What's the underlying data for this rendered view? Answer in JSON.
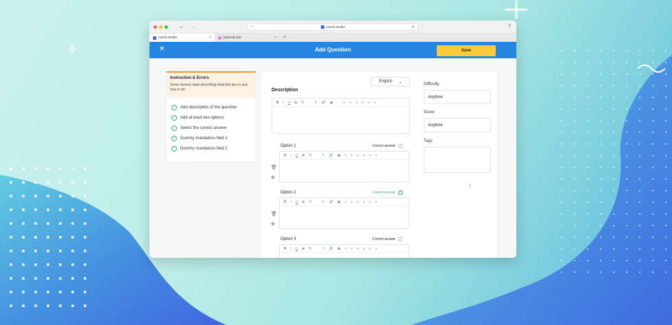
{
  "colors": {
    "brand": "#2685e0",
    "save": "#fbc93a",
    "success": "#3bb273",
    "warning_accent": "#f59a2b"
  },
  "browser": {
    "url": "numb.studio",
    "tabs": [
      {
        "label": "numb.studio",
        "close": "×"
      },
      {
        "label": "joseruiz.me",
        "close": "×"
      }
    ],
    "new_tab": "+"
  },
  "header": {
    "title": "Add Question",
    "close_icon": "✕",
    "save_label": "Save"
  },
  "instructions": {
    "title": "Instruction & Errors",
    "description": "Some dummy state describing what this box is and how to do",
    "items": [
      {
        "label": "Add description of the question"
      },
      {
        "label": "Add at least two options"
      },
      {
        "label": "Select the correct answer"
      },
      {
        "label": "Dummy mandatoru field 1"
      },
      {
        "label": "Dummy mandatoru field 2"
      }
    ]
  },
  "editor": {
    "language": "English",
    "description_label": "Description",
    "toolbar_icons": [
      "B",
      "I",
      "U",
      "S",
      "Tt",
      "✎",
      "🔗",
      "▣",
      "≡",
      "≡",
      "≡",
      "≡",
      "≡",
      "≡"
    ]
  },
  "options": [
    {
      "label": "Option 1",
      "correct_label": "Correct answer",
      "correct": false
    },
    {
      "label": "Option 2",
      "correct_label": "Correct answer",
      "correct": true
    },
    {
      "label": "Option 3",
      "correct_label": "Correct answer",
      "correct": false
    }
  ],
  "settings": {
    "difficulty_label": "Difficulty",
    "difficulty_value": "Anytime",
    "score_label": "Score",
    "score_value": "Anytime",
    "tags_label": "Tags",
    "tags_value": ""
  }
}
